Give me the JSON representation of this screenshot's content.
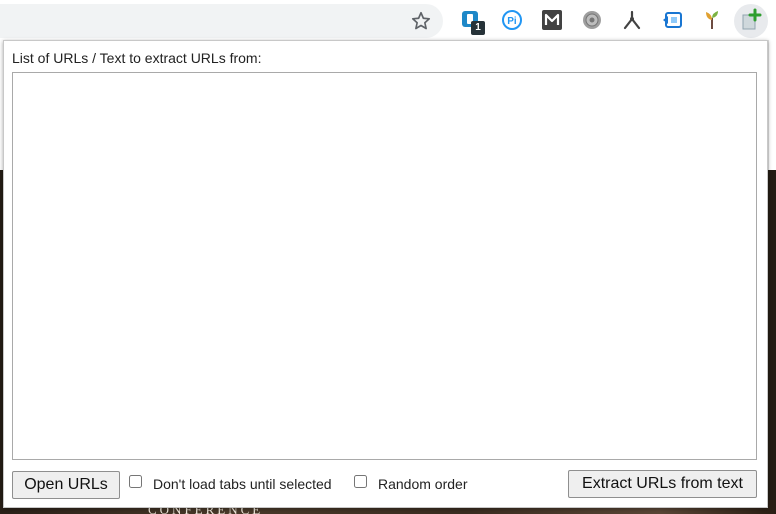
{
  "toolbar": {
    "extensions": [
      {
        "name": "pushbullet-extension",
        "badge": "1"
      },
      {
        "name": "pi-extension",
        "label": "Pi"
      },
      {
        "name": "mailtrack-extension",
        "label": "M"
      },
      {
        "name": "settings-gear-extension"
      },
      {
        "name": "compass-extension"
      },
      {
        "name": "tab-extension"
      },
      {
        "name": "plant-extension"
      },
      {
        "name": "open-multiple-urls-extension"
      }
    ]
  },
  "popup": {
    "label": "List of URLs / Text to extract URLs from:",
    "textarea_value": "",
    "open_button": "Open URLs",
    "lazy_label": "Don't load tabs until selected",
    "lazy_checked": false,
    "random_label": "Random order",
    "random_checked": false,
    "extract_button": "Extract URLs from text"
  },
  "background": {
    "conference_text": "CONFERENCE"
  },
  "colors": {
    "pushbullet": "#1e88c8",
    "pi": "#2196f3",
    "mailtrack": "#424242",
    "gear": "#9e9e9e",
    "compass": "#424242",
    "tab_ext": "#1976d2",
    "plant": "#e0a030",
    "plus_green": "#2e9e2e"
  }
}
